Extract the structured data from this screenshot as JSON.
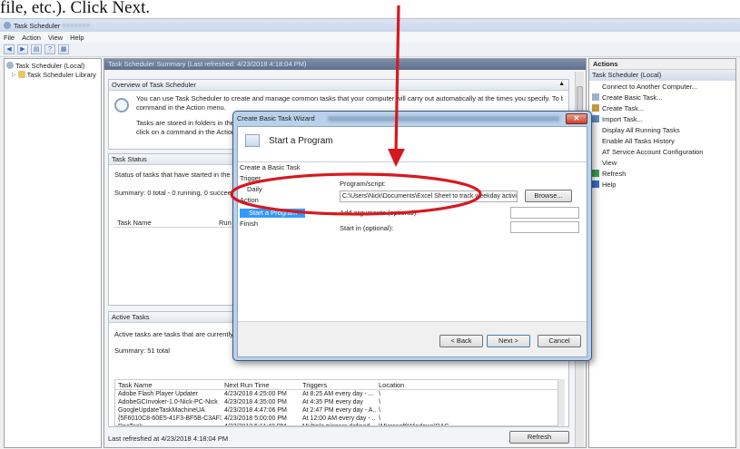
{
  "instruction": "file, etc.).  Click Next.",
  "window": {
    "title": "Task Scheduler",
    "menu": [
      "File",
      "Action",
      "View",
      "Help"
    ]
  },
  "tree": {
    "items": [
      "Task Scheduler (Local)",
      "Task Scheduler Library"
    ]
  },
  "summary": {
    "header": "Task Scheduler Summary (Last refreshed: 4/23/2018 4:18:04 PM)",
    "overview": {
      "title": "Overview of Task Scheduler",
      "line1": "You can use Task Scheduler to create and manage common tasks that your computer will carry out automatically at the times you specify. To begin, click a",
      "line2": "command in the Action menu.",
      "line3": "Tasks are stored in folders in the Task",
      "line4": "click on a command in the Action me"
    },
    "task_status": {
      "title": "Task Status",
      "desc": "Status of tasks that have started in the follow",
      "summary": "Summary: 0 total - 0 running, 0 succeeded,",
      "columns": [
        "Task Name",
        "Run R"
      ]
    },
    "active_tasks": {
      "title": "Active Tasks",
      "desc": "Active tasks are tasks that are currently enab",
      "summary": "Summary: 51 total",
      "columns": [
        "Task Name",
        "Next Run Time",
        "Triggers",
        "Location"
      ],
      "rows": [
        [
          "Adobe Flash Player Updater",
          "4/23/2018 4:25:00 PM",
          "At 8:25 AM every day - ...",
          "\\"
        ],
        [
          "AdobeGCInvoker-1.0-Nick-PC-Nick",
          "4/23/2018 4:35:00 PM",
          "At 4:35 PM every day",
          "\\"
        ],
        [
          "GoogleUpdateTaskMachineUA",
          "4/23/2018 4:47:06 PM",
          "At 2:47 PM every day - A...",
          "\\"
        ],
        [
          "{5F6010C8-60E5-41F3-BF5B-C3AF3...",
          "4/23/2018 5:00:00 PM",
          "At 12:00 AM every day - ...",
          "\\"
        ],
        [
          "RacTask",
          "4/23/2018 5:11:48 PM",
          "Multiple triggers defined",
          "\\Microsoft\\Windows\\RAC"
        ]
      ]
    },
    "footer": "Last refreshed at 4/23/2018 4:18:04 PM",
    "refresh_label": "Refresh"
  },
  "actions": {
    "header": "Actions",
    "section": "Task Scheduler (Local)",
    "items": [
      {
        "label": "Connect to Another Computer...",
        "icon": "computer-icon"
      },
      {
        "label": "Create Basic Task...",
        "icon": "create-basic-task-icon"
      },
      {
        "label": "Create Task...",
        "icon": "create-task-icon"
      },
      {
        "label": "Import Task...",
        "icon": "import-icon"
      },
      {
        "label": "Display All Running Tasks",
        "icon": "running-tasks-icon"
      },
      {
        "label": "Enable All Tasks History",
        "icon": "history-icon"
      },
      {
        "label": "AT Service Account Configuration",
        "icon": "config-icon"
      },
      {
        "label": "View",
        "icon": "view-icon"
      },
      {
        "label": "Refresh",
        "icon": "refresh-icon"
      },
      {
        "label": "Help",
        "icon": "help-icon"
      }
    ]
  },
  "wizard": {
    "title": "Create Basic Task Wizard",
    "heading": "Start a Program",
    "steps": [
      "Create a Basic Task",
      "Trigger",
      "Daily",
      "Action",
      "Start a Program",
      "Finish"
    ],
    "program_label": "Program/script:",
    "program_value": "C:\\Users\\Nick\\Documents\\Excel Sheet to track weekday activities.xlsx",
    "browse_label": "Browse...",
    "args_label": "Add arguments (optional):",
    "start_in_label": "Start in (optional):",
    "back_label": "< Back",
    "next_label": "Next >",
    "cancel_label": "Cancel"
  },
  "colors": {
    "annotation": "#d7191e",
    "selection": "#3399ff"
  }
}
